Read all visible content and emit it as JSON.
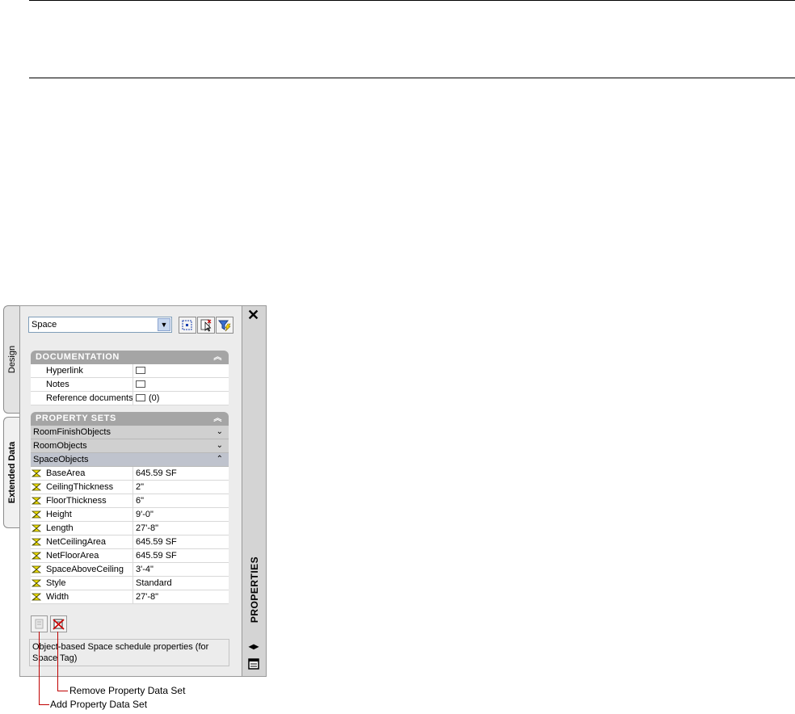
{
  "palette": {
    "tabs": [
      "Design",
      "Extended Data"
    ],
    "sidebar_title": "PROPERTIES",
    "close_glyph": "✕",
    "object_type": "Space",
    "documentation": {
      "header": "DOCUMENTATION",
      "rows": [
        {
          "name": "Hyperlink",
          "value": ""
        },
        {
          "name": "Notes",
          "value": ""
        },
        {
          "name": "Reference documents",
          "value": "(0)"
        }
      ]
    },
    "property_sets": {
      "header": "PROPERTY SETS",
      "groups": [
        "RoomFinishObjects",
        "RoomObjects",
        "SpaceObjects"
      ],
      "rows": [
        {
          "name": "BaseArea",
          "value": "645.59 SF"
        },
        {
          "name": "CeilingThickness",
          "value": "2\""
        },
        {
          "name": "FloorThickness",
          "value": "6\""
        },
        {
          "name": "Height",
          "value": "9'-0\""
        },
        {
          "name": "Length",
          "value": "27'-8\""
        },
        {
          "name": "NetCeilingArea",
          "value": "645.59 SF"
        },
        {
          "name": "NetFloorArea",
          "value": "645.59 SF"
        },
        {
          "name": "SpaceAboveCeiling",
          "value": "3'-4\""
        },
        {
          "name": "Style",
          "value": "Standard"
        },
        {
          "name": "Width",
          "value": "27'-8\""
        }
      ]
    },
    "description": "Object-based Space schedule properties (for Space Tag)"
  },
  "callouts": {
    "remove": "Remove Property Data Set",
    "add": "Add Property Data Set"
  },
  "icons": [
    "close-icon",
    "dropdown-arrow-icon",
    "select-objects-icon",
    "pick-object-icon",
    "quick-select-icon",
    "note-icon",
    "property-set-icon",
    "add-property-set-icon",
    "remove-property-set-icon",
    "collapse-icon",
    "expand-icon",
    "auto-hide-icon",
    "palette-menu-icon"
  ],
  "colors": {
    "section_header": "#a5a5a5",
    "callout": "#c00000",
    "active_group": "#bfc3cd"
  }
}
